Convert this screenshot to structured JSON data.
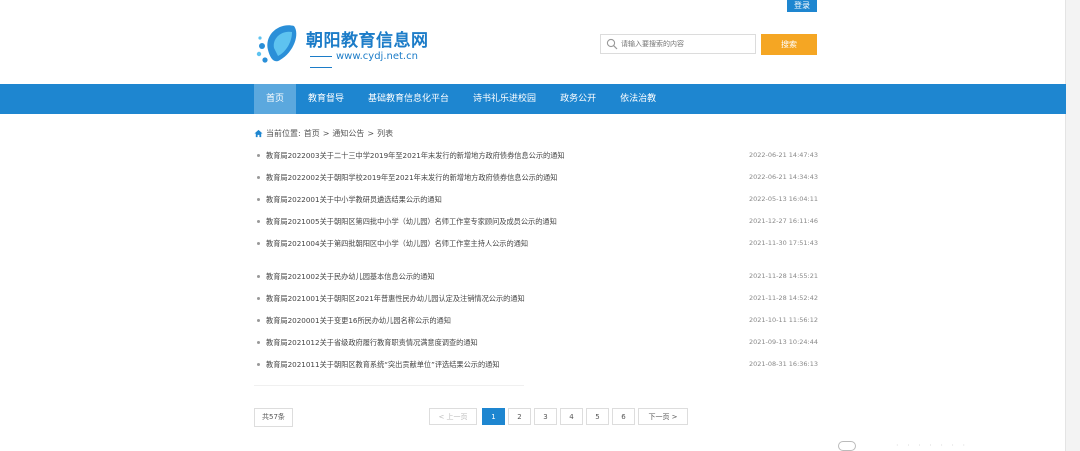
{
  "header": {
    "login_label": "登录",
    "site_title": "朝阳教育信息网",
    "site_url": "www.cydj.net.cn",
    "search_placeholder": "请输入要搜索的内容",
    "search_button": "搜索"
  },
  "nav": {
    "items": [
      {
        "label": "首页",
        "active": true
      },
      {
        "label": "教育督导",
        "active": false
      },
      {
        "label": "基础教育信息化平台",
        "active": false
      },
      {
        "label": "诗书礼乐进校园",
        "active": false
      },
      {
        "label": "政务公开",
        "active": false
      },
      {
        "label": "依法治教",
        "active": false
      }
    ]
  },
  "breadcrumb": {
    "prefix": "当前位置:",
    "items": [
      "首页",
      "通知公告",
      "列表"
    ],
    "separator": ">"
  },
  "notices": [
    {
      "title": "教育局2022003关于二十三中学2019年至2021年末发行的新增地方政府债券信息公示的通知",
      "date": "2022-06-21 14:47:43"
    },
    {
      "title": "教育局2022002关于朝阳学校2019年至2021年末发行的新增地方政府债券信息公示的通知",
      "date": "2022-06-21 14:34:43"
    },
    {
      "title": "教育局2022001关于中小学教研员遴选结果公示的通知",
      "date": "2022-05-13 16:04:11"
    },
    {
      "title": "教育局2021005关于朝阳区第四批中小学（幼儿园）名师工作室专家顾问及成员公示的通知",
      "date": "2021-12-27 16:11:46"
    },
    {
      "title": "教育局2021004关于第四批朝阳区中小学（幼儿园）名师工作室主持人公示的通知",
      "date": "2021-11-30 17:51:43"
    },
    {
      "title": "教育局2021002关于民办幼儿园基本信息公示的通知",
      "date": "2021-11-28 14:55:21"
    },
    {
      "title": "教育局2021001关于朝阳区2021年普惠性民办幼儿园认定及注销情况公示的通知",
      "date": "2021-11-28 14:52:42"
    },
    {
      "title": "教育局2020001关于变更16所民办幼儿园名称公示的通知",
      "date": "2021-10-11 11:56:12"
    },
    {
      "title": "教育局2021012关于省级政府履行教育职责情况满意度调查的通知",
      "date": "2021-09-13 10:24:44"
    },
    {
      "title": "教育局2021011关于朝阳区教育系统“突出贡献单位”评选结果公示的通知",
      "date": "2021-08-31 16:36:13"
    }
  ],
  "pagination": {
    "total": "共57条",
    "prev": "< 上一页",
    "pages": [
      "1",
      "2",
      "3",
      "4",
      "5",
      "6"
    ],
    "current": "1",
    "next": "下一页 >"
  },
  "colors": {
    "brand": "#1e86d0",
    "nav_active": "#5ba8de",
    "search_button": "#f5a623"
  }
}
